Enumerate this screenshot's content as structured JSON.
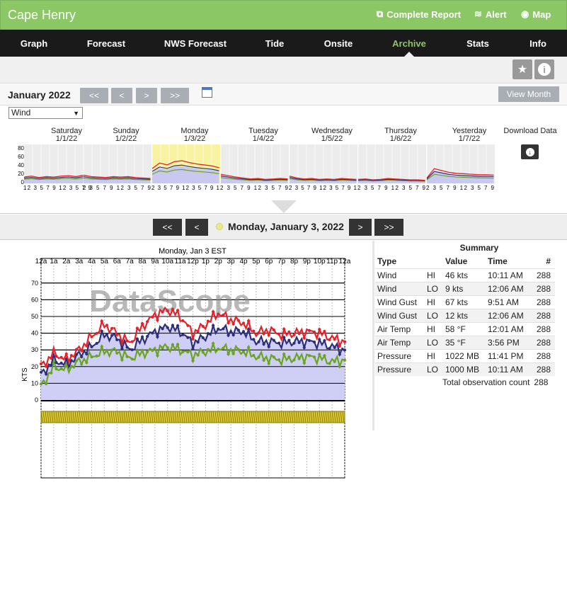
{
  "header": {
    "title": "Cape Henry",
    "links": [
      {
        "label": "Complete Report",
        "icon": "report-icon"
      },
      {
        "label": "Alert",
        "icon": "wifi-icon"
      },
      {
        "label": "Map",
        "icon": "globe-icon"
      }
    ]
  },
  "nav": {
    "items": [
      "Graph",
      "Forecast",
      "NWS Forecast",
      "Tide",
      "Onsite",
      "Archive",
      "Stats",
      "Info"
    ],
    "active": "Archive"
  },
  "archive": {
    "month": "January 2022",
    "buttons": [
      "<<",
      "<",
      ">",
      ">>"
    ],
    "view_month": "View Month",
    "parameter": "Wind"
  },
  "days": [
    {
      "name": "Saturday",
      "date": "1/1/22",
      "ticks": "12 3 5 7 9 12 3 5 7 9"
    },
    {
      "name": "Sunday",
      "date": "1/2/22",
      "ticks": "2 3 5 7 9 12 3 5 7 9"
    },
    {
      "name": "Monday",
      "date": "1/3/22",
      "ticks": "2 3 5 7 9 12 3 5 7 9 1"
    },
    {
      "name": "Tuesday",
      "date": "1/4/22",
      "ticks": "2 3 5 7 9 12 3 5 7 9"
    },
    {
      "name": "Wednesday",
      "date": "1/5/22",
      "ticks": "2 3 5 7 9 12 3 5 7 9 1"
    },
    {
      "name": "Thursday",
      "date": "1/6/22",
      "ticks": "2 3 5 7 9 12 3 5 7 9"
    },
    {
      "name": "Yesterday",
      "date": "1/7/22",
      "ticks": "2 3 5 7 9 12 3 5 7 9"
    }
  ],
  "mini_yaxis": [
    "80",
    "60",
    "40",
    "20",
    "0"
  ],
  "download": {
    "label": "Download Data"
  },
  "day_nav": {
    "buttons": [
      "<<",
      "<",
      ">",
      ">>"
    ],
    "date": "Monday, January 3, 2022"
  },
  "chart_data": {
    "type": "line",
    "title": "Monday, Jan 3 EST",
    "ylabel": "KTS",
    "watermark": "DataScope",
    "ylim": [
      0,
      75
    ],
    "yticks": [
      "0",
      "10",
      "20",
      "30",
      "40",
      "50",
      "60",
      "70"
    ],
    "xticks": [
      "12a",
      "1a",
      "2a",
      "3a",
      "4a",
      "5a",
      "6a",
      "7a",
      "8a",
      "9a",
      "10a",
      "11a",
      "12p",
      "1p",
      "2p",
      "3p",
      "4p",
      "5p",
      "6p",
      "7p",
      "8p",
      "9p",
      "10p",
      "11p",
      "12a"
    ],
    "series": [
      {
        "key": "gust",
        "color": "#e8202a",
        "values": [
          20,
          28,
          24,
          30,
          38,
          45,
          40,
          34,
          44,
          51,
          54,
          50,
          40,
          45,
          52,
          48,
          46,
          40,
          42,
          39,
          40,
          41,
          40,
          37,
          35
        ]
      },
      {
        "key": "wind",
        "color": "#2e2f7a",
        "values": [
          15,
          24,
          21,
          27,
          32,
          39,
          37,
          30,
          36,
          41,
          44,
          41,
          34,
          38,
          43,
          41,
          41,
          35,
          35,
          34,
          35,
          35,
          34,
          32,
          30
        ]
      },
      {
        "key": "low",
        "color": "#6aa422",
        "values": [
          8,
          20,
          18,
          23,
          26,
          29,
          29,
          25,
          28,
          30,
          32,
          30,
          27,
          29,
          31,
          30,
          29,
          26,
          25,
          24,
          25,
          26,
          25,
          23,
          24
        ]
      }
    ],
    "fill_color": "#cfcff5"
  },
  "summary": {
    "title": "Summary",
    "headers": [
      "Type",
      "",
      "Value",
      "Time",
      "#"
    ],
    "rows": [
      [
        "Wind",
        "HI",
        "46 kts",
        "10:11 AM",
        "288"
      ],
      [
        "Wind",
        "LO",
        "9 kts",
        "12:06 AM",
        "288"
      ],
      [
        "Wind Gust",
        "HI",
        "67 kts",
        "9:51 AM",
        "288"
      ],
      [
        "Wind Gust",
        "LO",
        "12 kts",
        "12:06 AM",
        "288"
      ],
      [
        "Air Temp",
        "HI",
        "58 °F",
        "12:01 AM",
        "288"
      ],
      [
        "Air Temp",
        "LO",
        "35 °F",
        "3:56 PM",
        "288"
      ],
      [
        "Pressure",
        "HI",
        "1022 MB",
        "11:41 PM",
        "288"
      ],
      [
        "Pressure",
        "LO",
        "1000 MB",
        "10:11 AM",
        "288"
      ]
    ],
    "total_label": "Total observation count",
    "total_value": "288"
  }
}
